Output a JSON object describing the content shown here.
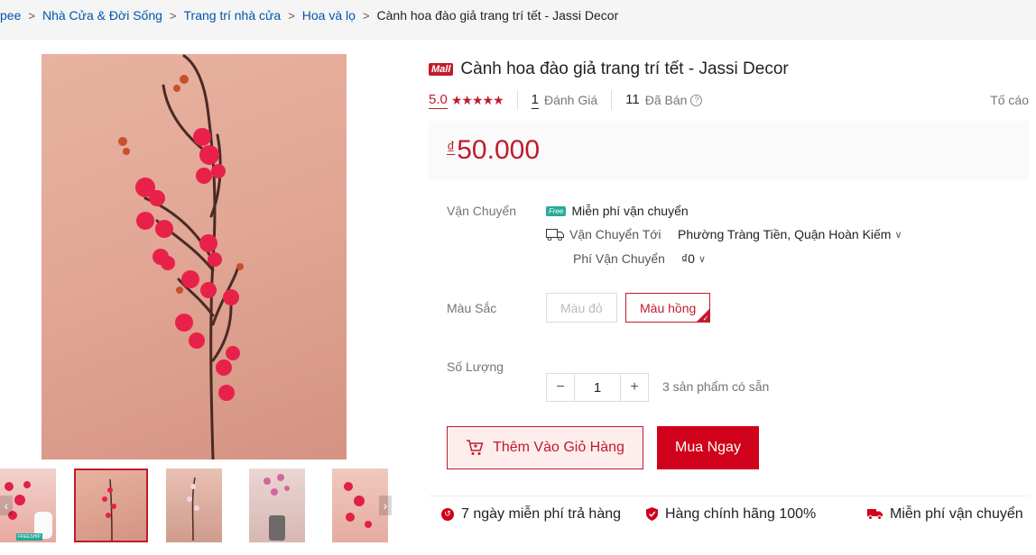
{
  "breadcrumb": {
    "items": [
      "pee",
      "Nhà Cửa & Đời Sống",
      "Trang trí nhà cửa",
      "Hoa và lọ"
    ],
    "current": "Cành hoa đào giả trang trí tết - Jassi Decor"
  },
  "product": {
    "mall_badge": "Mall",
    "title": "Cành hoa đào giả trang trí tết - Jassi Decor",
    "rating": "5.0",
    "stars": "★★★★★",
    "review_count": "1",
    "review_label": "Đánh Giá",
    "sold_count": "11",
    "sold_label": "Đã Bán",
    "report_label": "Tố cáo",
    "currency": "₫",
    "price": "50.000"
  },
  "shipping": {
    "label": "Vận Chuyển",
    "free_badge": "Free",
    "free_text": "Miễn phí vận chuyển",
    "to_label": "Vận Chuyển Tới",
    "to_value": "Phường Tràng Tiền, Quận Hoàn Kiếm",
    "fee_label": "Phí Vận Chuyển",
    "fee_value": "₫0"
  },
  "color": {
    "label": "Màu Sắc",
    "options": [
      "Màu đỏ",
      "Màu hồng"
    ],
    "selected": "Màu hồng"
  },
  "quantity": {
    "label": "Số Lượng",
    "minus": "−",
    "value": "1",
    "plus": "+",
    "stock": "3 sản phẩm có sẵn"
  },
  "actions": {
    "add_to_cart": "Thêm Vào Giỏ Hàng",
    "buy_now": "Mua Ngay"
  },
  "guarantees": {
    "returns": "7 ngày miễn phí trả hàng",
    "authentic": "Hàng chính hãng 100%",
    "free_ship": "Miễn phí vận chuyển"
  },
  "thumb_count": 5,
  "thumb_badge": "FREESHIP",
  "arrows": {
    "prev": "‹",
    "next": "›"
  },
  "colors": {
    "accent": "#c11b2c",
    "buy": "#d0011b",
    "link": "#0055aa"
  }
}
